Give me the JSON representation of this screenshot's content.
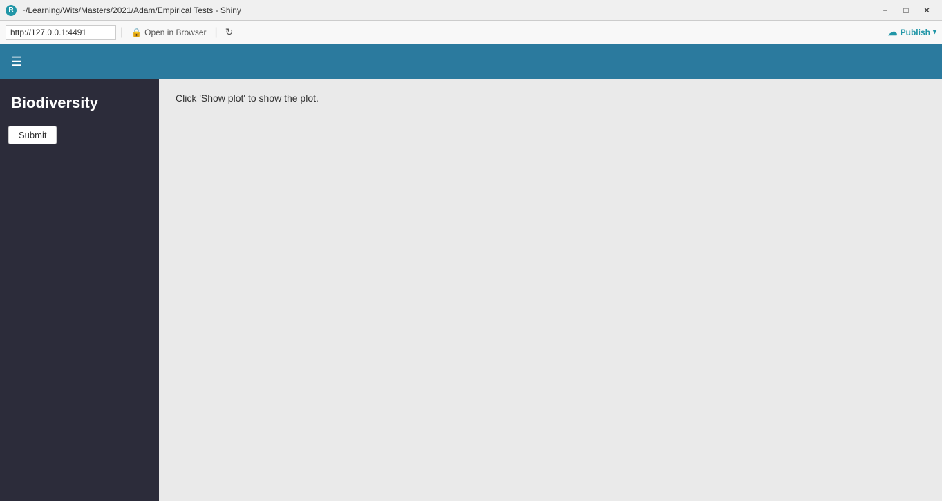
{
  "window": {
    "titlebar_text": "~/Learning/Wits/Masters/2021/Adam/Empirical Tests - Shiny",
    "icon_letter": "R",
    "minimize_label": "−",
    "maximize_label": "□",
    "close_label": "✕"
  },
  "addressbar": {
    "url_value": "http://127.0.0.1:4491",
    "open_in_browser_label": "Open in Browser",
    "reload_icon": "↻",
    "publish_label": "Publish",
    "lock_icon": "🔒"
  },
  "navbar": {
    "menu_icon": "☰"
  },
  "sidebar": {
    "title": "Biodiversity",
    "submit_label": "Submit"
  },
  "content": {
    "plot_message": "Click 'Show plot' to show the plot."
  }
}
